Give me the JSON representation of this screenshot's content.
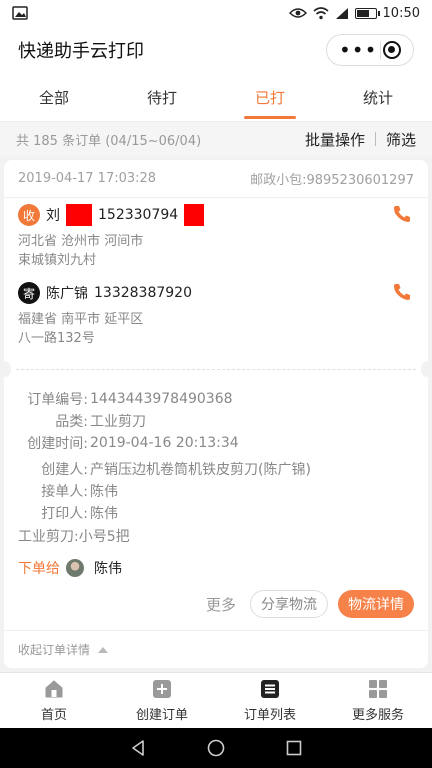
{
  "status_bar": {
    "time": "10:50"
  },
  "app": {
    "title": "快递助手云打印"
  },
  "tabs": [
    {
      "label": "全部"
    },
    {
      "label": "待打"
    },
    {
      "label": "已打"
    },
    {
      "label": "统计"
    }
  ],
  "summary": {
    "count_text": "共 185 条订单 (04/15~06/04)",
    "batch_label": "批量操作",
    "filter_label": "筛选"
  },
  "order": {
    "datetime": "2019-04-17 17:03:28",
    "tracking": "邮政小包:9895230601297",
    "receiver": {
      "badge": "收",
      "name": "刘",
      "phone": "152330794",
      "address_line1": "河北省 沧州市 河间市",
      "address_line2": "束城镇刘九村"
    },
    "sender": {
      "badge": "寄",
      "name": "陈广锦",
      "phone": "13328387920",
      "address_line1": "福建省 南平市 延平区",
      "address_line2": "八一路132号"
    },
    "details": {
      "order_no_label": "订单编号:",
      "order_no": "1443443978490368",
      "category_label": "品类:",
      "category": "工业剪刀",
      "created_label": "创建时间:",
      "created": "2019-04-16 20:13:34",
      "creator_label": "创建人:",
      "creator": "产销压边机卷筒机铁皮剪刀(陈广锦)",
      "taker_label": "接单人:",
      "taker": "陈伟",
      "printer_label": "打印人:",
      "printer": "陈伟",
      "goods": "工业剪刀:小号5把",
      "assign_to_label": "下单给",
      "assign_to_name": "陈伟"
    },
    "actions": {
      "more": "更多",
      "share": "分享物流",
      "logistics": "物流详情"
    },
    "collapse_label": "收起订单详情"
  },
  "bottom_nav": [
    {
      "label": "首页",
      "icon": "home-icon"
    },
    {
      "label": "创建订单",
      "icon": "plus-square-icon"
    },
    {
      "label": "订单列表",
      "icon": "list-icon"
    },
    {
      "label": "更多服务",
      "icon": "grid-icon"
    }
  ],
  "colors": {
    "accent": "#f2793a",
    "primary_button": "#f6824a"
  }
}
